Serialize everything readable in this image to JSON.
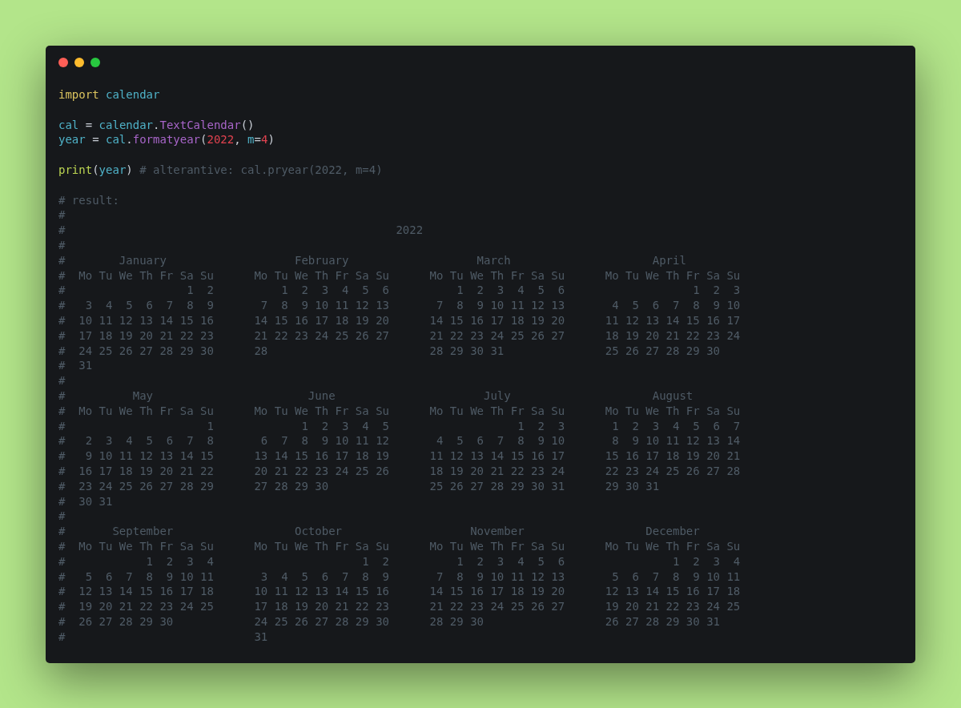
{
  "window": {
    "controls": [
      {
        "kind": "close"
      },
      {
        "kind": "minimize"
      },
      {
        "kind": "zoom"
      }
    ]
  },
  "code_blocks": [
    [
      [
        {
          "kind": "keyword",
          "text": "import"
        },
        {
          "kind": "name",
          "text": " calendar"
        }
      ]
    ],
    [
      [
        {
          "kind": "name",
          "text": "cal"
        },
        {
          "kind": "plain",
          "text": " = "
        },
        {
          "kind": "name",
          "text": "calendar"
        },
        {
          "kind": "plain",
          "text": "."
        },
        {
          "kind": "function",
          "text": "TextCalendar"
        },
        {
          "kind": "plain",
          "text": "()"
        }
      ],
      [
        {
          "kind": "name",
          "text": "year"
        },
        {
          "kind": "plain",
          "text": " = "
        },
        {
          "kind": "name",
          "text": "cal"
        },
        {
          "kind": "plain",
          "text": "."
        },
        {
          "kind": "function",
          "text": "formatyear"
        },
        {
          "kind": "plain",
          "text": "("
        },
        {
          "kind": "number",
          "text": "2022"
        },
        {
          "kind": "plain",
          "text": ", "
        },
        {
          "kind": "name",
          "text": "m"
        },
        {
          "kind": "plain",
          "text": "="
        },
        {
          "kind": "number",
          "text": "4"
        },
        {
          "kind": "plain",
          "text": ")"
        }
      ]
    ],
    [
      [
        {
          "kind": "builtin",
          "text": "print"
        },
        {
          "kind": "plain",
          "text": "("
        },
        {
          "kind": "name",
          "text": "year"
        },
        {
          "kind": "plain",
          "text": ") "
        },
        {
          "kind": "comment",
          "text": "# alterantive: cal.pryear(2022, m=4)"
        }
      ]
    ],
    [
      [
        {
          "kind": "comment",
          "text": "# result:"
        }
      ],
      [
        {
          "kind": "comment",
          "text": "#"
        }
      ],
      [
        {
          "kind": "comment",
          "text": "#                                                 2022"
        }
      ],
      [
        {
          "kind": "comment",
          "text": "#"
        }
      ],
      [
        {
          "kind": "comment",
          "text": "#        January                   February                   March                     April"
        }
      ],
      [
        {
          "kind": "comment",
          "text": "#  Mo Tu We Th Fr Sa Su      Mo Tu We Th Fr Sa Su      Mo Tu We Th Fr Sa Su      Mo Tu We Th Fr Sa Su"
        }
      ],
      [
        {
          "kind": "comment",
          "text": "#                  1  2          1  2  3  4  5  6          1  2  3  4  5  6                   1  2  3"
        }
      ],
      [
        {
          "kind": "comment",
          "text": "#   3  4  5  6  7  8  9       7  8  9 10 11 12 13       7  8  9 10 11 12 13       4  5  6  7  8  9 10"
        }
      ],
      [
        {
          "kind": "comment",
          "text": "#  10 11 12 13 14 15 16      14 15 16 17 18 19 20      14 15 16 17 18 19 20      11 12 13 14 15 16 17"
        }
      ],
      [
        {
          "kind": "comment",
          "text": "#  17 18 19 20 21 22 23      21 22 23 24 25 26 27      21 22 23 24 25 26 27      18 19 20 21 22 23 24"
        }
      ],
      [
        {
          "kind": "comment",
          "text": "#  24 25 26 27 28 29 30      28                        28 29 30 31               25 26 27 28 29 30"
        }
      ],
      [
        {
          "kind": "comment",
          "text": "#  31"
        }
      ],
      [
        {
          "kind": "comment",
          "text": "#"
        }
      ],
      [
        {
          "kind": "comment",
          "text": "#          May                       June                      July                     August"
        }
      ],
      [
        {
          "kind": "comment",
          "text": "#  Mo Tu We Th Fr Sa Su      Mo Tu We Th Fr Sa Su      Mo Tu We Th Fr Sa Su      Mo Tu We Th Fr Sa Su"
        }
      ],
      [
        {
          "kind": "comment",
          "text": "#                     1             1  2  3  4  5                   1  2  3       1  2  3  4  5  6  7"
        }
      ],
      [
        {
          "kind": "comment",
          "text": "#   2  3  4  5  6  7  8       6  7  8  9 10 11 12       4  5  6  7  8  9 10       8  9 10 11 12 13 14"
        }
      ],
      [
        {
          "kind": "comment",
          "text": "#   9 10 11 12 13 14 15      13 14 15 16 17 18 19      11 12 13 14 15 16 17      15 16 17 18 19 20 21"
        }
      ],
      [
        {
          "kind": "comment",
          "text": "#  16 17 18 19 20 21 22      20 21 22 23 24 25 26      18 19 20 21 22 23 24      22 23 24 25 26 27 28"
        }
      ],
      [
        {
          "kind": "comment",
          "text": "#  23 24 25 26 27 28 29      27 28 29 30               25 26 27 28 29 30 31      29 30 31"
        }
      ],
      [
        {
          "kind": "comment",
          "text": "#  30 31"
        }
      ],
      [
        {
          "kind": "comment",
          "text": "#"
        }
      ],
      [
        {
          "kind": "comment",
          "text": "#       September                  October                   November                  December"
        }
      ],
      [
        {
          "kind": "comment",
          "text": "#  Mo Tu We Th Fr Sa Su      Mo Tu We Th Fr Sa Su      Mo Tu We Th Fr Sa Su      Mo Tu We Th Fr Sa Su"
        }
      ],
      [
        {
          "kind": "comment",
          "text": "#            1  2  3  4                      1  2          1  2  3  4  5  6                1  2  3  4"
        }
      ],
      [
        {
          "kind": "comment",
          "text": "#   5  6  7  8  9 10 11       3  4  5  6  7  8  9       7  8  9 10 11 12 13       5  6  7  8  9 10 11"
        }
      ],
      [
        {
          "kind": "comment",
          "text": "#  12 13 14 15 16 17 18      10 11 12 13 14 15 16      14 15 16 17 18 19 20      12 13 14 15 16 17 18"
        }
      ],
      [
        {
          "kind": "comment",
          "text": "#  19 20 21 22 23 24 25      17 18 19 20 21 22 23      21 22 23 24 25 26 27      19 20 21 22 23 24 25"
        }
      ],
      [
        {
          "kind": "comment",
          "text": "#  26 27 28 29 30            24 25 26 27 28 29 30      28 29 30                  26 27 28 29 30 31"
        }
      ],
      [
        {
          "kind": "comment",
          "text": "#                            31"
        }
      ]
    ]
  ]
}
